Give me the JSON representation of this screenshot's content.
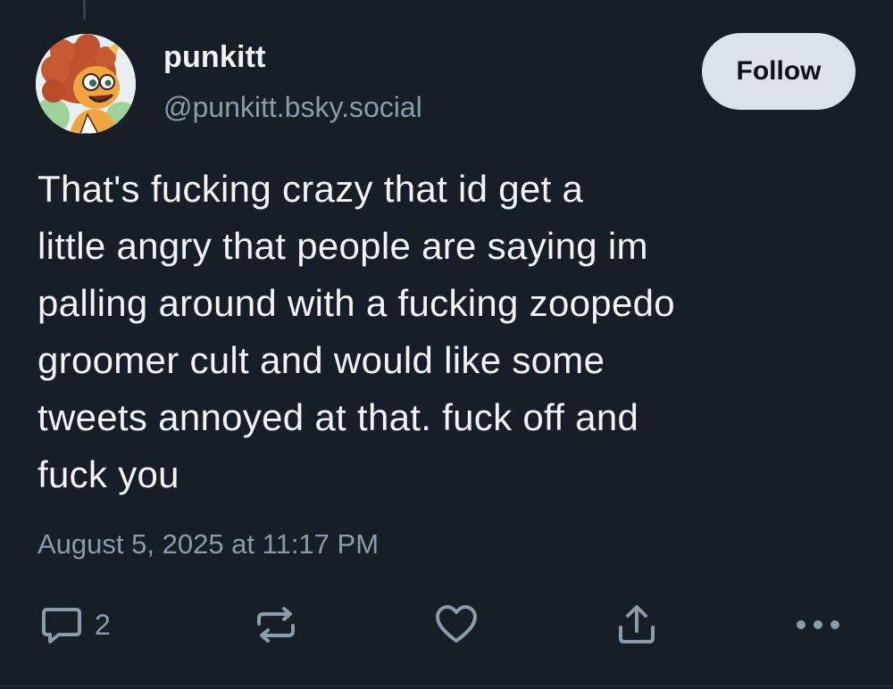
{
  "post": {
    "author": {
      "display_name": "punkitt",
      "handle": "@punkitt.bsky.social",
      "avatar_icon": "cartoon-character-avatar"
    },
    "follow_label": "Follow",
    "text": "That's fucking crazy that id get a\nlittle angry that people are saying im\npalling around with a fucking zoopedo\ngroomer cult and would like some\ntweets annoyed at that. fuck off and\nfuck you",
    "timestamp": "August 5, 2025 at 11:17 PM",
    "actions": {
      "reply_icon": "speech-bubble-icon",
      "reply_count": "2",
      "repost_icon": "repost-arrows-icon",
      "like_icon": "heart-icon",
      "share_icon": "share-upload-icon",
      "more_icon": "more-dots-icon"
    }
  },
  "colors": {
    "background": "#161e27",
    "primary_text": "#f1f3f5",
    "secondary_text": "#8c9bab",
    "follow_button_bg": "#dce2ea",
    "thread_line": "#2e4052"
  }
}
